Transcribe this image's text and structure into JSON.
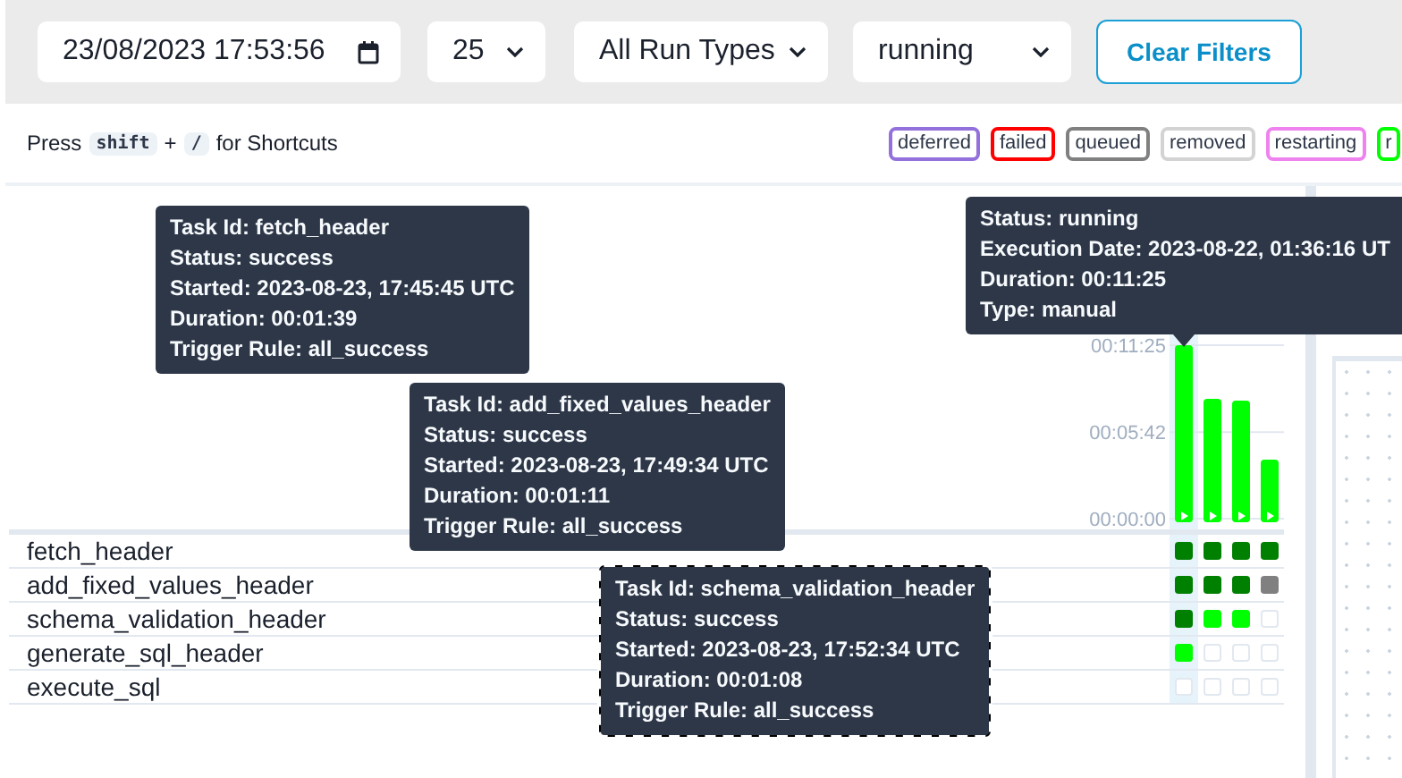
{
  "filters": {
    "date": "23/08/2023 17:53:56",
    "limit": "25",
    "run_type": "All Run Types",
    "run_state": "running",
    "clear_button": "Clear Filters"
  },
  "shortcut_hint": {
    "prefix": "Press",
    "keys": [
      "shift",
      "/"
    ],
    "joiner": "+",
    "suffix": "for Shortcuts"
  },
  "legend": [
    {
      "label": "deferred",
      "color": "#9370db"
    },
    {
      "label": "failed",
      "color": "#ff0000"
    },
    {
      "label": "queued",
      "color": "#808080"
    },
    {
      "label": "removed",
      "color": "#d3d3d3"
    },
    {
      "label": "restarting",
      "color": "#ee82ee"
    },
    {
      "label": "r",
      "color": "#00ff00"
    }
  ],
  "runs": [
    {
      "kind": "manual",
      "selected": true
    },
    {
      "kind": "manual",
      "selected": false
    },
    {
      "kind": "manual",
      "selected": false
    },
    {
      "kind": "manual",
      "selected": false
    }
  ],
  "duration_chart": {
    "chart_data": {
      "type": "bar",
      "values": [
        685,
        473,
        466,
        233
      ],
      "ylim": [
        0,
        685
      ],
      "yticks": [
        {
          "value": 0,
          "label": "00:00:00"
        },
        {
          "value": 342,
          "label": "00:05:42"
        },
        {
          "value": 685,
          "label": "00:11:25"
        }
      ]
    }
  },
  "tasks": [
    {
      "name": "fetch_header",
      "instances": [
        {
          "kind": "success"
        },
        {
          "kind": "success"
        },
        {
          "kind": "success"
        },
        {
          "kind": "success"
        }
      ]
    },
    {
      "name": "add_fixed_values_header",
      "instances": [
        {
          "kind": "success"
        },
        {
          "kind": "success"
        },
        {
          "kind": "success"
        },
        {
          "kind": "queued"
        }
      ]
    },
    {
      "name": "schema_validation_header",
      "instances": [
        {
          "kind": "success"
        },
        {
          "kind": "running"
        },
        {
          "kind": "running"
        },
        {
          "kind": "none"
        }
      ]
    },
    {
      "name": "generate_sql_header",
      "instances": [
        {
          "kind": "running"
        },
        {
          "kind": "none"
        },
        {
          "kind": "none"
        },
        {
          "kind": "none"
        }
      ]
    },
    {
      "name": "execute_sql",
      "instances": [
        {
          "kind": "none"
        },
        {
          "kind": "none"
        },
        {
          "kind": "none"
        },
        {
          "kind": "none"
        }
      ]
    }
  ],
  "tooltips": [
    {
      "kind": "task",
      "focused": false,
      "lines": [
        "Task Id: fetch_header",
        "Status: success",
        "Started: 2023-08-23, 17:45:45 UTC",
        "Duration: 00:01:39",
        "Trigger Rule: all_success"
      ]
    },
    {
      "kind": "task",
      "focused": false,
      "lines": [
        "Task Id: add_fixed_values_header",
        "Status: success",
        "Started: 2023-08-23, 17:49:34 UTC",
        "Duration: 00:01:11",
        "Trigger Rule: all_success"
      ]
    },
    {
      "kind": "task",
      "focused": true,
      "lines": [
        "Task Id: schema_validation_header",
        "Status: success",
        "Started: 2023-08-23, 17:52:34 UTC",
        "Duration: 00:01:08",
        "Trigger Rule: all_success"
      ]
    },
    {
      "kind": "run",
      "focused": false,
      "lines": [
        "Status: running",
        "Execution Date: 2023-08-22, 01:36:16 UT",
        "Duration: 00:11:25",
        "Type: manual"
      ]
    }
  ]
}
